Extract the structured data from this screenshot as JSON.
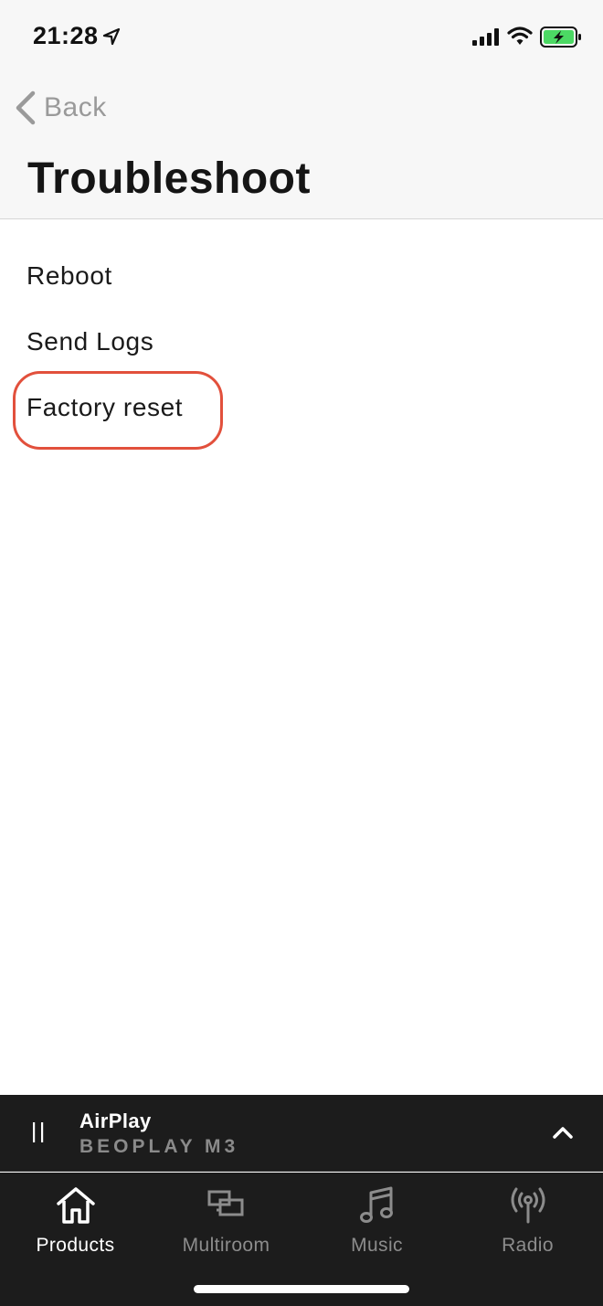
{
  "status_bar": {
    "time": "21:28"
  },
  "header": {
    "back_label": "Back",
    "title": "Troubleshoot"
  },
  "menu": {
    "items": [
      {
        "label": "Reboot"
      },
      {
        "label": "Send Logs"
      },
      {
        "label": "Factory reset"
      }
    ]
  },
  "player": {
    "source": "AirPlay",
    "device": "BEOPLAY M3"
  },
  "tabs": [
    {
      "label": "Products",
      "icon": "home-icon",
      "active": true
    },
    {
      "label": "Multiroom",
      "icon": "multiroom-icon",
      "active": false
    },
    {
      "label": "Music",
      "icon": "music-note-icon",
      "active": false
    },
    {
      "label": "Radio",
      "icon": "radio-antenna-icon",
      "active": false
    }
  ],
  "colors": {
    "highlight": "#e2503c",
    "battery_charge": "#4cd964",
    "dark_bar": "#1c1c1c",
    "header_bg": "#f7f7f7"
  }
}
